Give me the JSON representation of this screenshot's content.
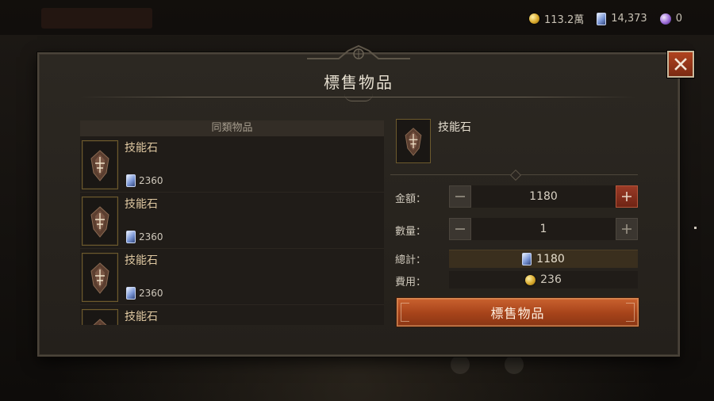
{
  "currency": {
    "gold": "113.2萬",
    "platinum": "14,373",
    "orbs": "0"
  },
  "dialog": {
    "title": "標售物品",
    "close_label": "close"
  },
  "similar_items": {
    "header": "同類物品",
    "rows": [
      {
        "name": "技能石",
        "price": "2360"
      },
      {
        "name": "技能石",
        "price": "2360"
      },
      {
        "name": "技能石",
        "price": "2360"
      },
      {
        "name": "技能石",
        "price": ""
      }
    ]
  },
  "selected_item": {
    "name": "技能石"
  },
  "form": {
    "price_label": "金額：",
    "price_value": "1180",
    "quantity_label": "數量：",
    "quantity_value": "1",
    "total_label": "總計：",
    "total_value": "1180",
    "fee_label": "費用：",
    "fee_value": "236"
  },
  "submit_label": "標售物品",
  "colors": {
    "accent": "#b24a1f",
    "item_name": "#e0c9a2"
  },
  "icons": {
    "gold": "gold-coin-icon",
    "platinum": "platinum-gem-icon",
    "orb": "orb-icon",
    "item": "skill-stone-icon"
  }
}
